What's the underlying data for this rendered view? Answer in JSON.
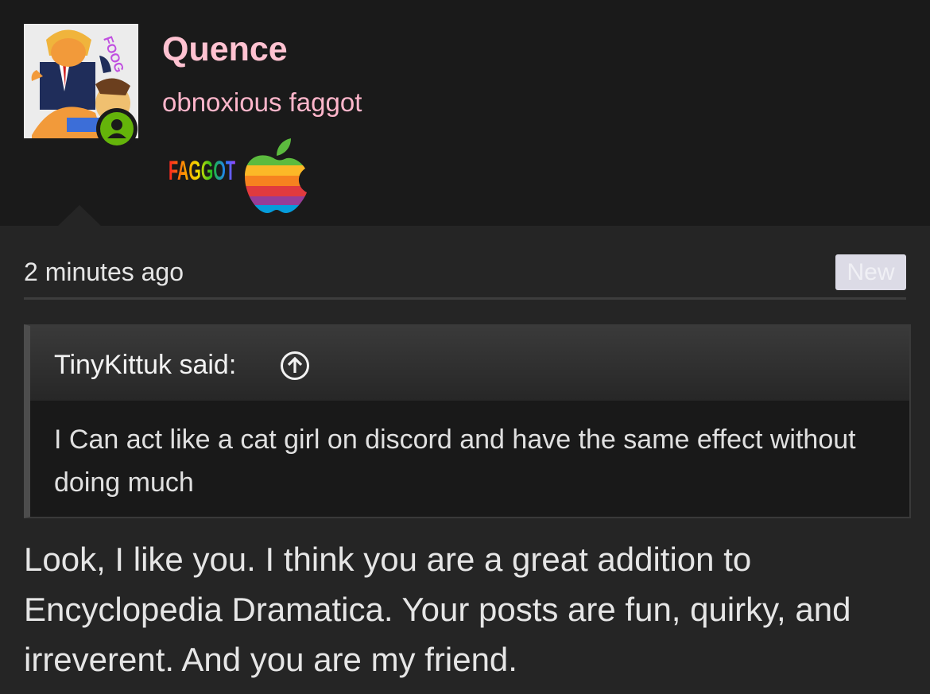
{
  "user": {
    "name": "Quence",
    "title": "obnoxious faggot",
    "banner_text": "FAGGOT",
    "avatar_text": "FOOG"
  },
  "post": {
    "time": "2 minutes ago",
    "badge": "New",
    "quote": {
      "author": "TinyKittuk said:",
      "text": "I Can act like a cat girl on discord and have the same effect without doing much"
    },
    "message": "Look, I like you. I think you are a great addition to Encyclopedia Dramatica. Your posts are fun, quirky, and irreverent. And you are my friend."
  },
  "colors": {
    "username": "#ffc2d1",
    "online": "#64b40a",
    "background": "#252525",
    "header": "#1a1a1a"
  }
}
